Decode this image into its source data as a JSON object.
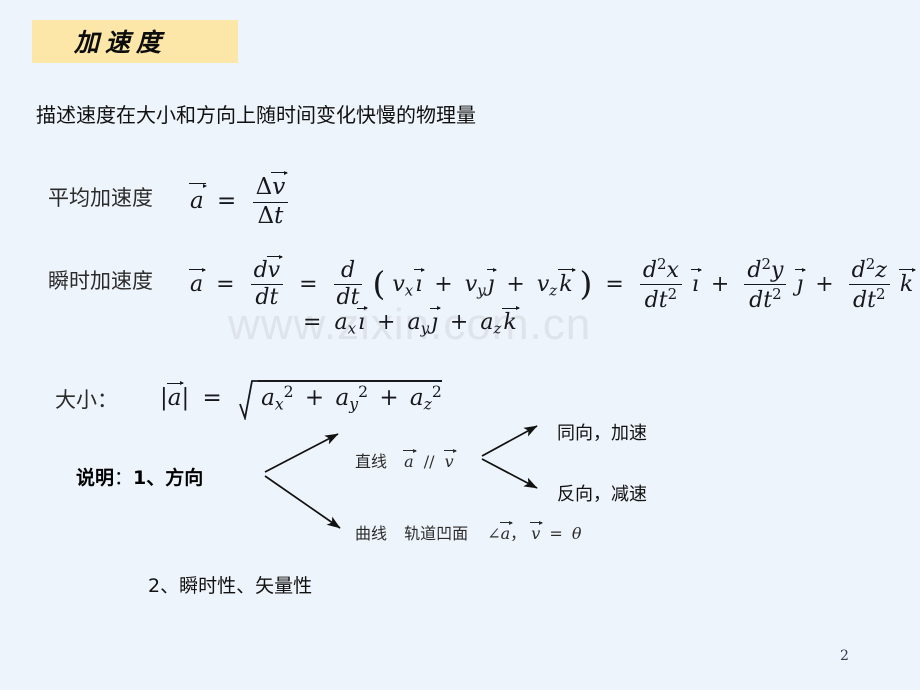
{
  "slide": {
    "background_color": "#eef4fb",
    "page_number": "2",
    "watermark": "www.zixin.com.cn",
    "title": {
      "text": "加速度",
      "box_color": "#fde7a8"
    },
    "lead_sentence": "描述速度在大小和方向上随时间变化快慢的物理量"
  },
  "formulas": {
    "average": {
      "label": "平均加速度",
      "lhs_symbol": "a",
      "equals": "=",
      "numerator_delta": "Δ",
      "numerator_var": "v",
      "denominator_delta": "Δ",
      "denominator_var": "t",
      "plain": "平均加速度  ā = Δv̄ / Δt"
    },
    "instant": {
      "label": "瞬时加速度",
      "lhs_symbol": "a",
      "eq1": "=",
      "d_num": "d",
      "d_num_var": "v",
      "d_den": "dt",
      "eq2": "=",
      "op_num": "d",
      "op_den": "dt",
      "open_paren": "(",
      "term_vx": "v",
      "sub_x": "x",
      "unit_i": "ı",
      "plus1": "+",
      "term_vy": "v",
      "sub_y": "y",
      "unit_j": "ȷ",
      "plus2": "+",
      "term_vz": "v",
      "sub_z": "z",
      "unit_k": "k",
      "close_paren": ")",
      "eq3": "=",
      "d2x_num": "d",
      "d2x_exp": "2",
      "d2x_var": "x",
      "d2_den": "dt",
      "d2_den_exp": "2",
      "d2y_var": "y",
      "d2z_var": "z",
      "plain": "瞬时加速度  a⃗ = dv⃗/dt = d/dt (vx ı⃗ + vy ȷ⃗ + vz k⃗) = d²x/dt² ı⃗ + d²y/dt² ȷ⃗ + d²z/dt² k⃗"
    },
    "instant_line2": {
      "equals": "=",
      "term_ax": "a",
      "sub_x": "x",
      "unit_i": "ı",
      "plus1": "+",
      "term_ay": "a",
      "sub_y": "y",
      "unit_j": "ȷ",
      "plus2": "+",
      "term_az": "a",
      "sub_z": "z",
      "unit_k": "k",
      "plain": "= ax ı⃗ + ay ȷ⃗ + az k⃗"
    },
    "magnitude": {
      "label": "大小：",
      "lhs": "|a⃗|",
      "equals": "=",
      "radicand_ax": "a",
      "sub_x": "x",
      "exp_x": "2",
      "plus1": "+",
      "radicand_ay": "a",
      "sub_y": "y",
      "exp_y": "2",
      "plus2": "+",
      "radicand_az": "a",
      "sub_z": "z",
      "exp_z": "2",
      "plain": "大小：|a⃗| = √(ax² + ay² + az²)"
    }
  },
  "notes": {
    "head_bold": "说明",
    "head_colon": "：",
    "head_rest": "1、方向",
    "head_plain": "说明：1、方向",
    "branches": [
      {
        "id": "straight",
        "label_cn": "直线",
        "relation_a": "a",
        "parallel": "//",
        "relation_v": "v",
        "plain": "直线  a⃗ // v⃗"
      },
      {
        "id": "curve",
        "label_cn": "曲线",
        "detail_cn": "轨道凹面",
        "angle_symbol": "∠",
        "angle_a": "a",
        "angle_comma": "，",
        "angle_v": "v",
        "angle_equals": "=",
        "angle_theta": "θ",
        "plain": "曲线  轨道凹面  ∠a⃗，v⃗ = θ"
      }
    ],
    "outcomes": [
      {
        "id": "same-direction",
        "text": "同向，加速"
      },
      {
        "id": "opposite-direction",
        "text": "反向，减速"
      }
    ],
    "second_point": "2、瞬时性、矢量性"
  }
}
